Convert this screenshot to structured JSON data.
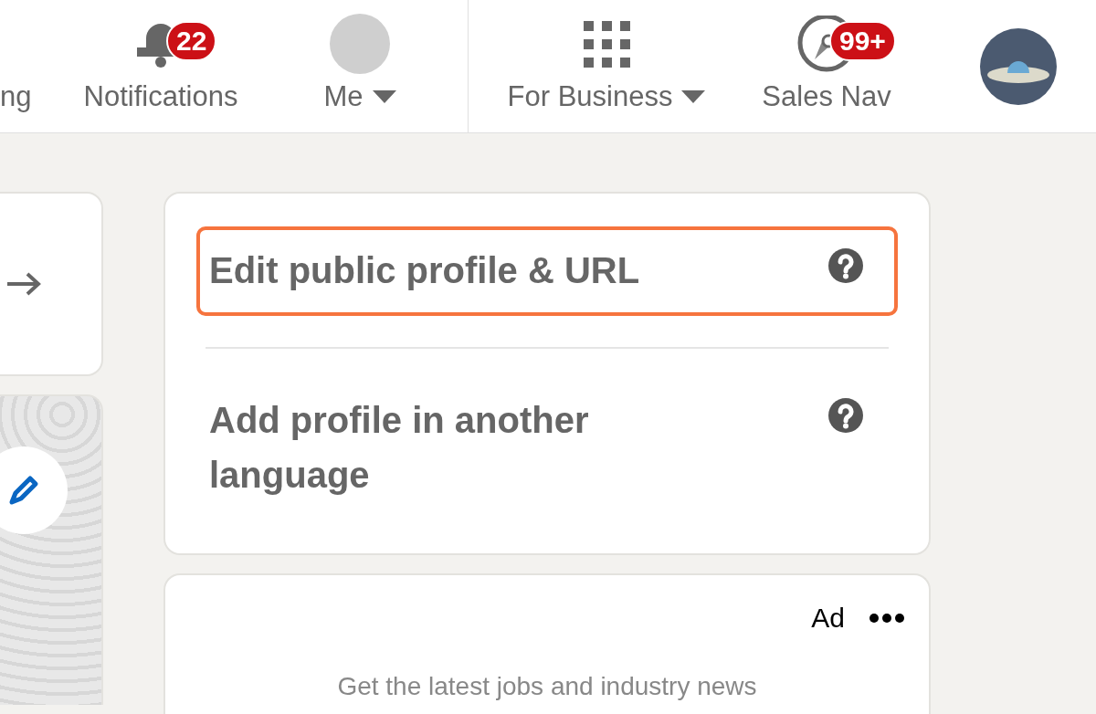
{
  "nav": {
    "items": [
      {
        "kind": "text",
        "label": "ng"
      },
      {
        "kind": "bell",
        "label": "Notifications",
        "badge": "22"
      },
      {
        "kind": "avatar",
        "label": "Me",
        "dropdown": true
      },
      {
        "kind": "separator"
      },
      {
        "kind": "grid",
        "label": "For Business",
        "dropdown": true
      },
      {
        "kind": "compass",
        "label": "Sales Nav",
        "badge": "99+"
      },
      {
        "kind": "logo"
      }
    ]
  },
  "profile_links": [
    {
      "label": "Edit public profile & URL",
      "highlighted": true
    },
    {
      "label": "Add profile in another language",
      "highlighted": false
    }
  ],
  "ad": {
    "tag": "Ad",
    "text": "Get the latest jobs and industry news"
  }
}
